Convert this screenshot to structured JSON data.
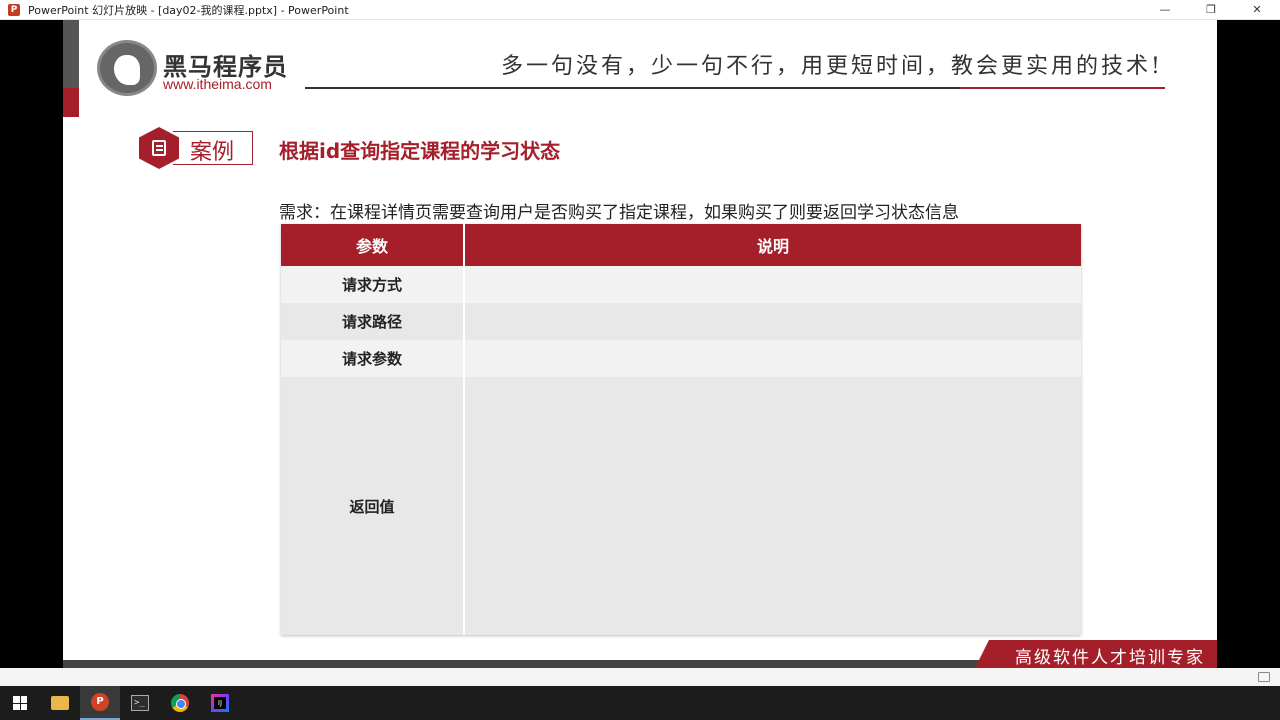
{
  "window": {
    "title": "PowerPoint 幻灯片放映 - [day02-我的课程.pptx] - PowerPoint",
    "minimize": "—",
    "restore": "❐",
    "close": "✕"
  },
  "slide": {
    "logo_name": "黑马程序员",
    "logo_url": "www.itheima.com",
    "slogan": "多一句没有，少一句不行，用更短时间，教会更实用的技术!",
    "case_label": "案例",
    "case_title": "根据id查询指定课程的学习状态",
    "requirement": "需求：在课程详情页需要查询用户是否购买了指定课程，如果购买了则要返回学习状态信息",
    "table": {
      "headers": [
        "参数",
        "说明"
      ],
      "rows": [
        {
          "param": "请求方式",
          "desc": ""
        },
        {
          "param": "请求路径",
          "desc": ""
        },
        {
          "param": "请求参数",
          "desc": ""
        },
        {
          "param": "返回值",
          "desc": ""
        }
      ]
    },
    "ribbon_text": "高级软件人才培训专家"
  },
  "colors": {
    "brand_red": "#a51f2b",
    "dark_gray": "#444444"
  },
  "taskbar": {
    "items": [
      "windows-start-icon",
      "file-explorer-icon",
      "powerpoint-icon",
      "terminal-icon",
      "chrome-icon",
      "intellij-idea-icon"
    ]
  }
}
